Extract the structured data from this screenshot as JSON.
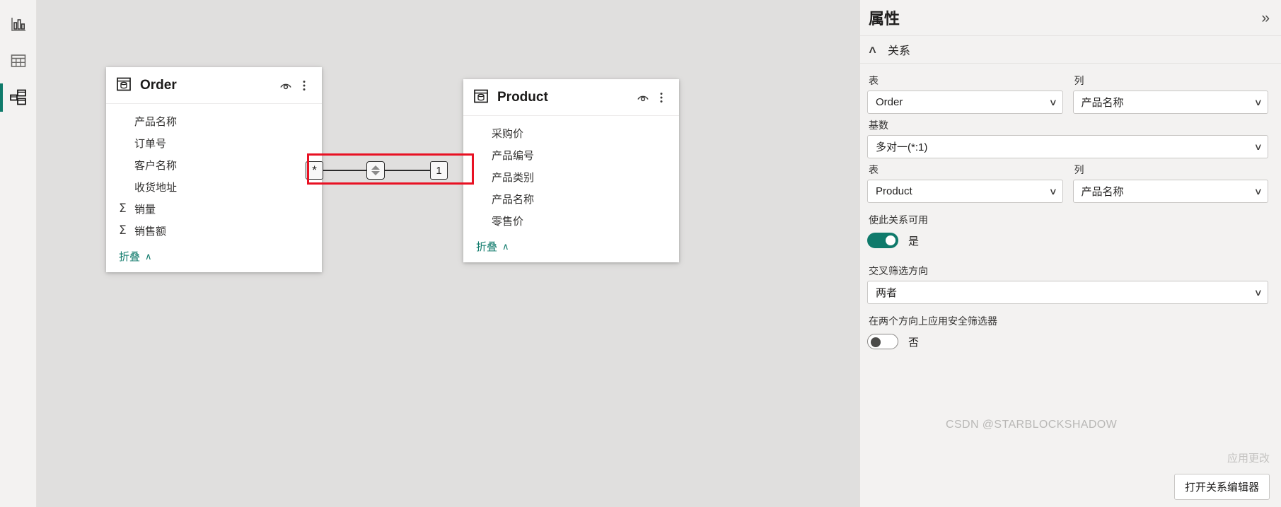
{
  "left_rail": {
    "items": [
      {
        "name": "report-view",
        "icon": "bar-chart-icon",
        "active": false
      },
      {
        "name": "data-view",
        "icon": "table-grid-icon",
        "active": false
      },
      {
        "name": "model-view",
        "icon": "model-relationship-icon",
        "active": true
      }
    ]
  },
  "canvas": {
    "tables": [
      {
        "name": "Order",
        "icon": "table-card-icon",
        "header_icons": [
          "eye-hide-icon",
          "more-options-icon"
        ],
        "fields": [
          {
            "label": "产品名称",
            "measure": false
          },
          {
            "label": "订单号",
            "measure": false
          },
          {
            "label": "客户名称",
            "measure": false
          },
          {
            "label": "收货地址",
            "measure": false
          },
          {
            "label": "销量",
            "measure": true
          },
          {
            "label": "销售额",
            "measure": true
          }
        ],
        "collapse_label": "折叠"
      },
      {
        "name": "Product",
        "icon": "table-card-icon",
        "header_icons": [
          "eye-hide-icon",
          "more-options-icon"
        ],
        "fields": [
          {
            "label": "采购价",
            "measure": false
          },
          {
            "label": "产品编号",
            "measure": false
          },
          {
            "label": "产品类别",
            "measure": false
          },
          {
            "label": "产品名称",
            "measure": false
          },
          {
            "label": "零售价",
            "measure": false
          }
        ],
        "collapse_label": "折叠"
      }
    ],
    "relationship": {
      "many_side_label": "*",
      "one_side_label": "1",
      "direction_icon": "both-directions-arrow-icon",
      "highlight_color": "#e81123"
    }
  },
  "properties_pane": {
    "title": "属性",
    "collapse_icon": "chevron-double-right-icon",
    "section": {
      "label": "关系",
      "chevron": "∧"
    },
    "from_table_label": "表",
    "from_column_label": "列",
    "from_table_value": "Order",
    "from_column_value": "产品名称",
    "cardinality_label": "基数",
    "cardinality_value": "多对一(*:1)",
    "to_table_label": "表",
    "to_column_label": "列",
    "to_table_value": "Product",
    "to_column_value": "产品名称",
    "active_label": "使此关系可用",
    "active_toggle_text": "是",
    "active_toggle_state": "on",
    "cross_filter_label": "交叉筛选方向",
    "cross_filter_value": "两者",
    "security_filter_label": "在两个方向上应用安全筛选器",
    "security_toggle_text": "否",
    "security_toggle_state": "off",
    "apply_changes_label": "应用更改",
    "open_editor_label": "打开关系编辑器",
    "accent_color": "#0f7a6b"
  },
  "watermark": "CSDN @STARBLOCKSHADOW"
}
